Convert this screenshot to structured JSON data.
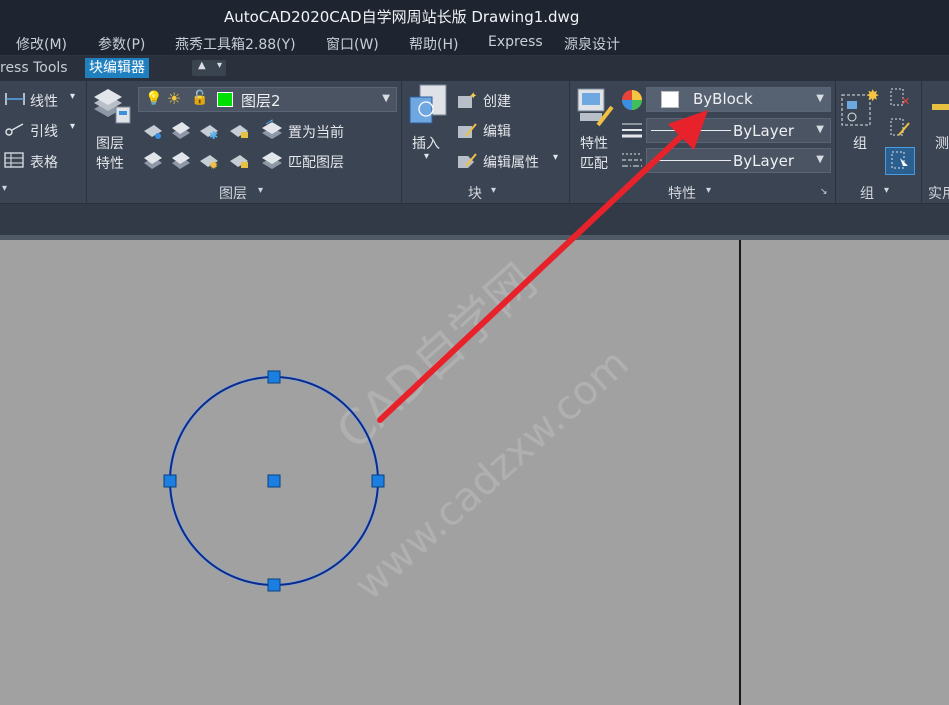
{
  "window": {
    "title": "AutoCAD2020CAD自学网周站长版    Drawing1.dwg"
  },
  "menu": [
    "修改(M)",
    "参数(P)",
    "燕秀工具箱2.88(Y)",
    "窗口(W)",
    "帮助(H)",
    "Express",
    "源泉设计"
  ],
  "tabs": {
    "express": "ress Tools",
    "block_editor": "块编辑器"
  },
  "ribbon": {
    "annotation": {
      "linear": "线性",
      "leader": "引线",
      "table": "表格"
    },
    "layers": {
      "properties_line1": "图层",
      "properties_line2": "特性",
      "current_layer": "图层2",
      "current_layer_color": "#00e000",
      "set_current": "置为当前",
      "match_layer": "匹配图层",
      "title": "图层"
    },
    "block": {
      "insert": "插入",
      "create": "创建",
      "edit": "编辑",
      "edit_attributes": "编辑属性",
      "title": "块"
    },
    "properties": {
      "match_line1": "特性",
      "match_line2": "匹配",
      "color": "ByBlock",
      "lineweight": "ByLayer",
      "linetype": "ByLayer",
      "title": "特性"
    },
    "group": {
      "label": "组",
      "title": "组"
    },
    "measure": {
      "label": "测"
    },
    "utilities": {
      "title": "实用"
    }
  },
  "colors": {
    "accent": "#1f7fbf",
    "selection_grip": "#1a7fe0",
    "circle": "#0b2a8a",
    "arrow": "#e8222a",
    "canvas": "#a1a1a1"
  },
  "watermark": {
    "line1": "CAD自学网",
    "line2": "www.cadzxw.com"
  }
}
